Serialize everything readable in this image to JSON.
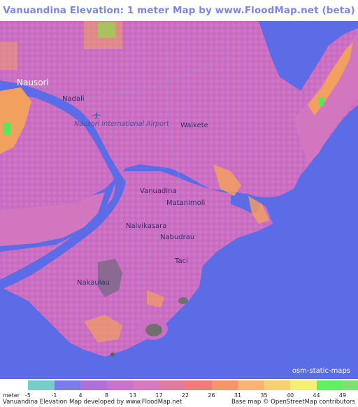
{
  "title": "Vanuandina Elevation: 1 meter Map by www.FloodMap.net (beta)",
  "colors": {
    "water": "#5b6ce6",
    "low_land": "#cc6fc4",
    "mid_land": "#e07aa0",
    "high_land": "#f2a060",
    "peak": "#54e85a",
    "dark_hill": "#606060"
  },
  "places": {
    "nausori": "Nausori",
    "nadali": "Nadali",
    "airport": "Nausori International Airport",
    "waikete": "Waikete",
    "vanuadina": "Vanuadina",
    "matanimoli": "Matanimoli",
    "naivikasara": "Naivikasara",
    "nabudrau": "Nabudrau",
    "taci": "Taci",
    "nakaulau": "Nakaulau"
  },
  "airport_icon": "airplane-icon",
  "osm_badge": "osm-static-maps",
  "legend": {
    "unit": "meter",
    "items": [
      {
        "value": "-5",
        "color": "#75cfc6"
      },
      {
        "value": "-1",
        "color": "#7b7bf0"
      },
      {
        "value": "4",
        "color": "#b070d8"
      },
      {
        "value": "8",
        "color": "#c874cc"
      },
      {
        "value": "13",
        "color": "#d879c0"
      },
      {
        "value": "17",
        "color": "#e07aa0"
      },
      {
        "value": "22",
        "color": "#f47a7a"
      },
      {
        "value": "26",
        "color": "#f7946e"
      },
      {
        "value": "31",
        "color": "#f8b470"
      },
      {
        "value": "35",
        "color": "#f8d070"
      },
      {
        "value": "40",
        "color": "#f4f070"
      },
      {
        "value": "44",
        "color": "#60f060"
      },
      {
        "value": "49",
        "color": "#80e070"
      }
    ]
  },
  "credit_left": "Vanuandina Elevation Map developed by www.FloodMap.net",
  "credit_right": "Base map © OpenStreetMap contributors"
}
